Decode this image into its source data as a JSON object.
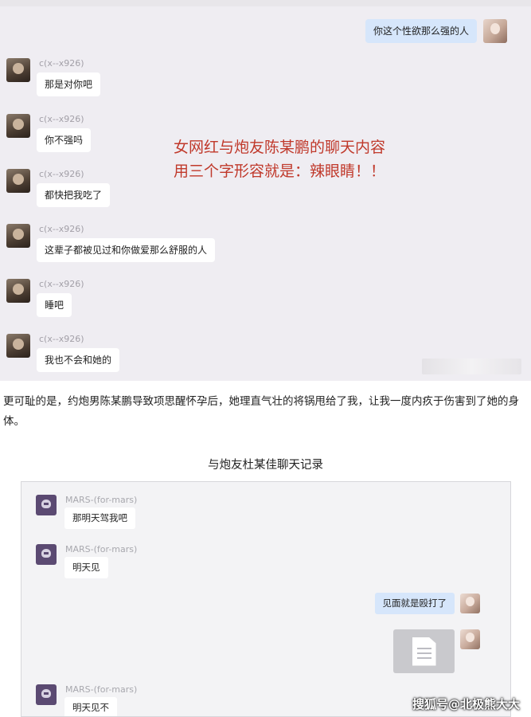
{
  "chat1": {
    "my_message": "你这个性欲那么强的人",
    "messages": [
      {
        "sender": "c(x--x926)",
        "text": "那是对你吧"
      },
      {
        "sender": "c(x--x926)",
        "text": "你不强吗"
      },
      {
        "sender": "c(x--x926)",
        "text": "都快把我吃了"
      },
      {
        "sender": "c(x--x926)",
        "text": "这辈子都被见过和你做爱那么舒服的人"
      },
      {
        "sender": "c(x--x926)",
        "text": "睡吧"
      },
      {
        "sender": "c(x--x926)",
        "text": "我也不会和她的"
      }
    ],
    "overlay_line1": "女网红与炮友陈某鹏的聊天内容",
    "overlay_line2": "用三个字形容就是：辣眼睛！！",
    "overlay_color": "#c0392b"
  },
  "paragraph": "更可耻的是，约炮男陈某鹏导致项思醒怀孕后，她理直气壮的将锅甩给了我，让我一度内疚于伤害到了她的身体。",
  "chat2": {
    "title": "与炮友杜某佳聊天记录",
    "messages": [
      {
        "sender": "MARS-(for-mars)",
        "text": "那明天驾我吧"
      },
      {
        "sender": "MARS-(for-mars)",
        "text": "明天见"
      },
      {
        "sender": "MARS-(for-mars)",
        "text": "明天见不"
      }
    ],
    "my_message": "见面就是殴打了"
  },
  "watermark": "搜狐号@北极熊大大",
  "icons": {
    "file": "file-document-icon"
  }
}
